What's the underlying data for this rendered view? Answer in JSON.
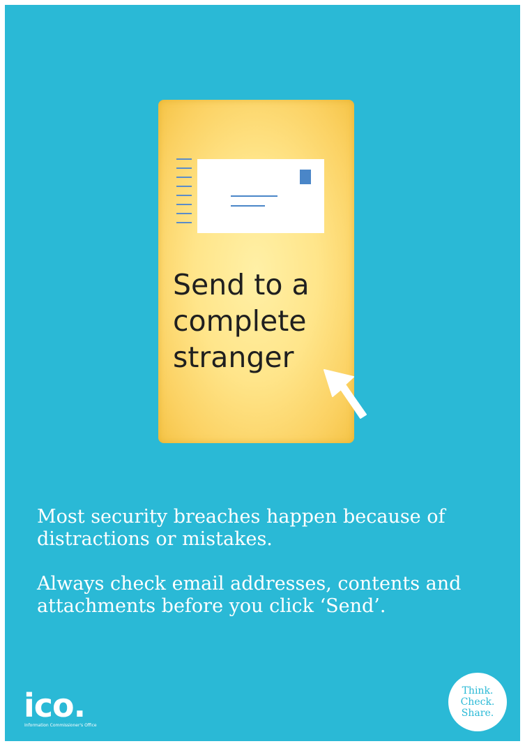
{
  "card": {
    "lines": [
      "Send to a",
      "complete",
      "stranger"
    ]
  },
  "message": {
    "paragraph_1": "Most security breaches happen because of distractions or mistakes.",
    "paragraph_2": "Always check email addresses, contents and attachments before you click ‘Send’."
  },
  "logo": {
    "wordmark": "ico.",
    "subtitle": "Information Commissioner's Office"
  },
  "badge": {
    "line_1": "Think.",
    "line_2": "Check.",
    "line_3": "Share."
  },
  "colors": {
    "background": "#2ab9d6",
    "card": "#ffe58a",
    "accent_blue": "#4a86c8",
    "text_dark": "#1f1f1f"
  },
  "icons": [
    "envelope-icon",
    "stamp-icon",
    "cursor-arrow-icon",
    "ico-logo"
  ]
}
